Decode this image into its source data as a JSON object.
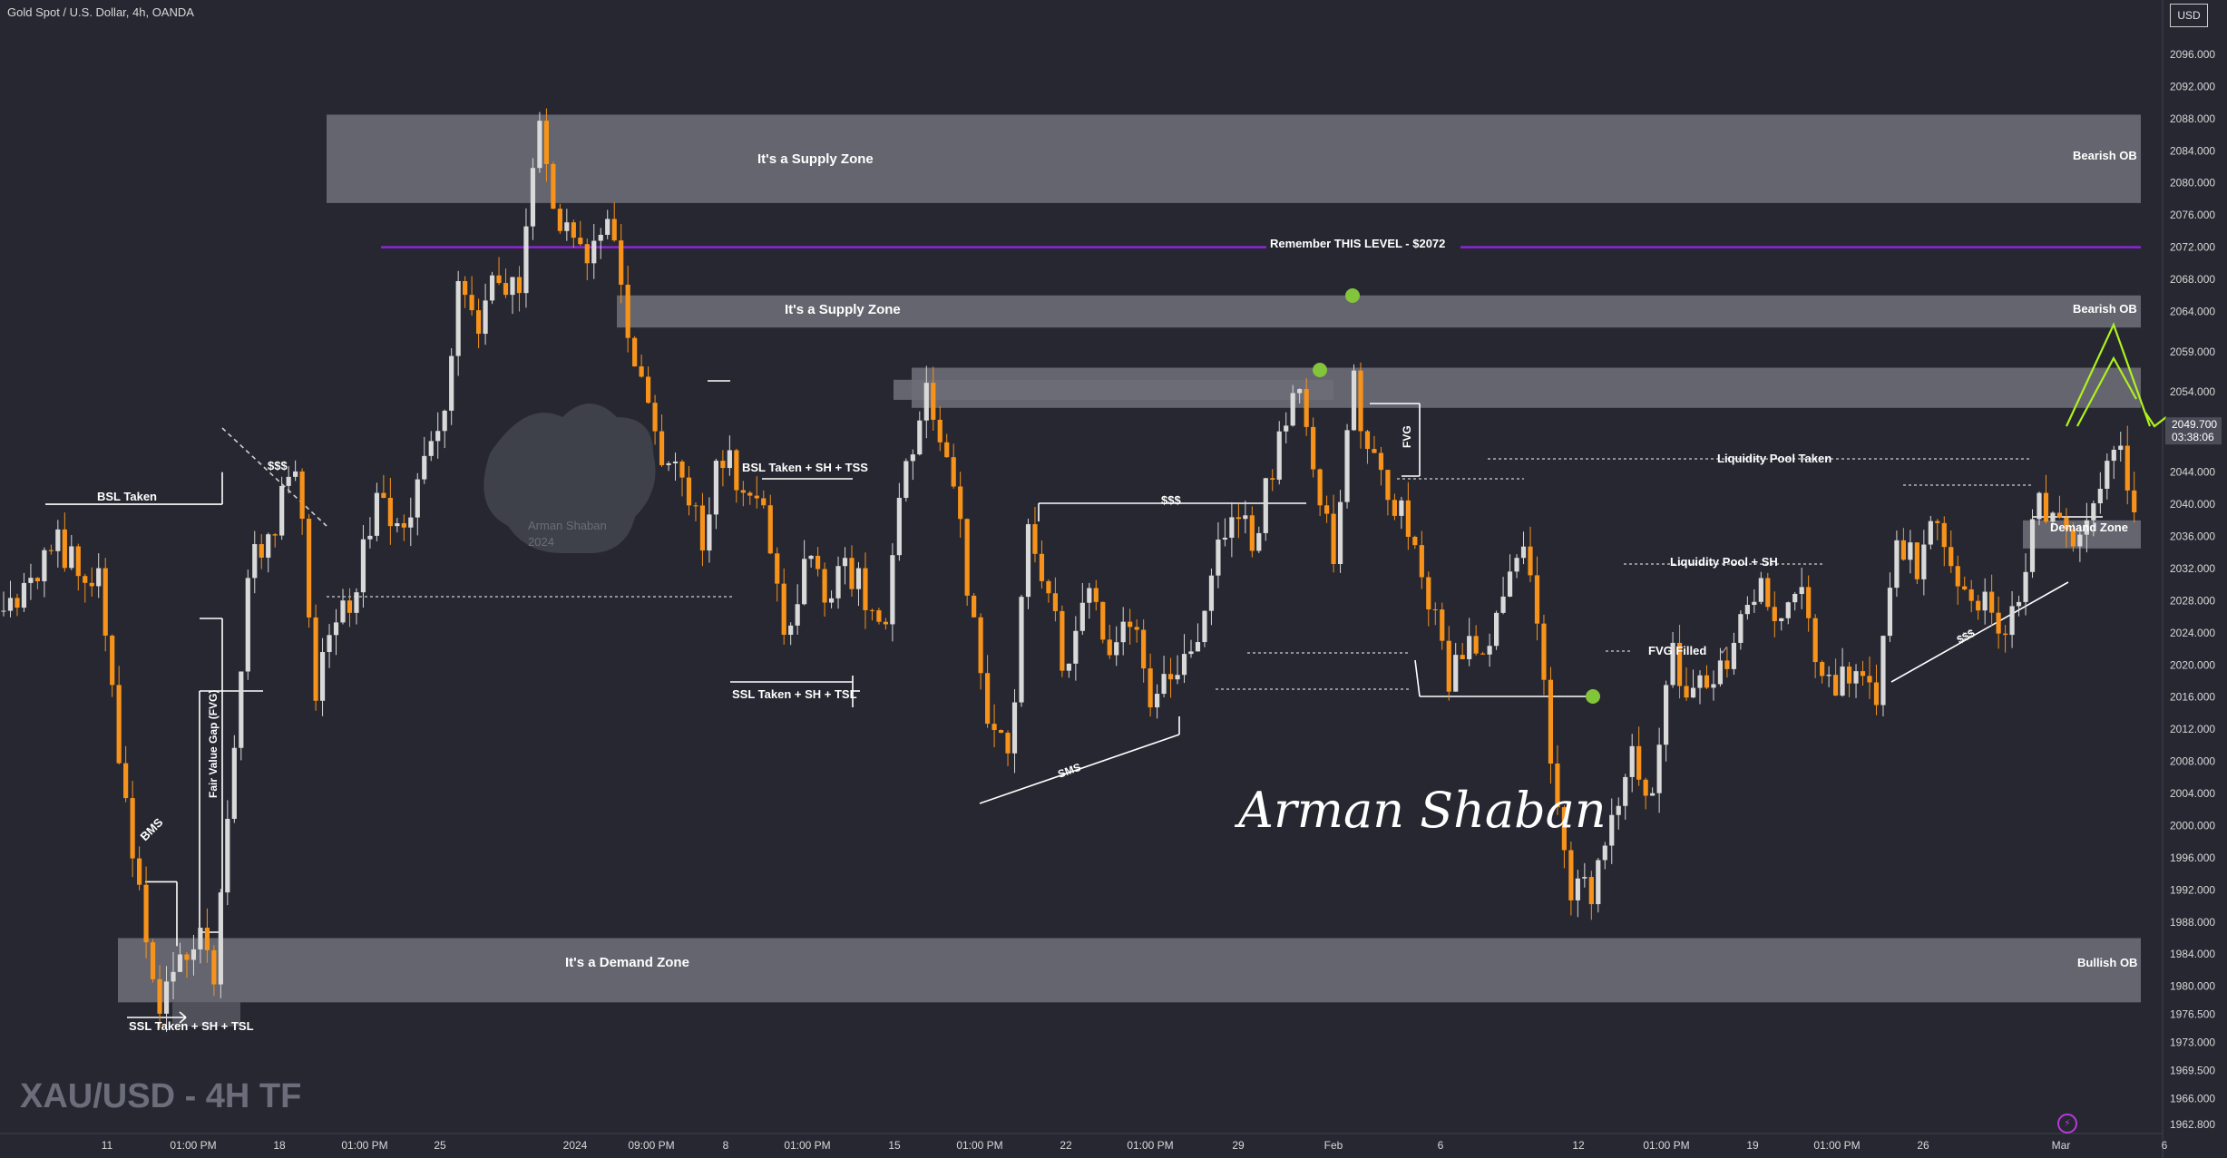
{
  "header": {
    "symbol": "Gold Spot / U.S. Dollar, 4h, OANDA",
    "currency": "USD"
  },
  "bottom_title": "XAU/USD - 4H TF",
  "watermark": {
    "name": "Arman Shaban",
    "year": "2024"
  },
  "signature": "Arman Shaban",
  "colors": {
    "background": "#262731",
    "up_candle": "#d9d9d9",
    "down_candle": "#f7931a",
    "zone": "#6c6d77",
    "purple_line": "#8e24d6",
    "green_arrow": "#aef21d",
    "green_dot": "#82c43a"
  },
  "chart_data": {
    "type": "candlestick",
    "title": "Gold Spot / U.S. Dollar, 4h, OANDA",
    "y_axis": {
      "side": "right",
      "unit": "USD",
      "ticks": [
        "2096.000",
        "2092.000",
        "2088.000",
        "2084.000",
        "2080.000",
        "2076.000",
        "2072.000",
        "2068.000",
        "2064.000",
        "2059.000",
        "2054.000",
        "2049.700",
        "2044.000",
        "2040.000",
        "2036.000",
        "2032.000",
        "2028.000",
        "2024.000",
        "2020.000",
        "2016.000",
        "2012.000",
        "2008.000",
        "2004.000",
        "2000.000",
        "1996.000",
        "1992.000",
        "1988.000",
        "1984.000",
        "1980.000",
        "1976.500",
        "1973.000",
        "1969.500",
        "1966.000",
        "1962.800"
      ],
      "current_price": "2049.700",
      "countdown": "03:38:06"
    },
    "x_axis": {
      "ticks": [
        "11",
        "01:00 PM",
        "18",
        "01:00 PM",
        "25",
        "2024",
        "09:00 PM",
        "8",
        "01:00 PM",
        "15",
        "01:00 PM",
        "22",
        "01:00 PM",
        "29",
        "Feb",
        "6",
        "12",
        "01:00 PM",
        "19",
        "01:00 PM",
        "26",
        "Mar",
        "6"
      ]
    },
    "price_range": [
      1962.8,
      2096.0
    ],
    "close_path": [
      [
        0,
        2026
      ],
      [
        8,
        2035
      ],
      [
        14,
        2030
      ],
      [
        18,
        2003
      ],
      [
        21,
        1985
      ],
      [
        23,
        1978
      ],
      [
        26,
        1983
      ],
      [
        29,
        1986
      ],
      [
        31,
        1980
      ],
      [
        33,
        1999
      ],
      [
        36,
        2032
      ],
      [
        40,
        2038
      ],
      [
        43,
        2046
      ],
      [
        46,
        2018
      ],
      [
        49,
        2025
      ],
      [
        52,
        2030
      ],
      [
        55,
        2040
      ],
      [
        58,
        2036
      ],
      [
        61,
        2042
      ],
      [
        64,
        2048
      ],
      [
        67,
        2066
      ],
      [
        70,
        2063
      ],
      [
        73,
        2069
      ],
      [
        76,
        2066
      ],
      [
        79,
        2088
      ],
      [
        81,
        2076
      ],
      [
        83,
        2073
      ],
      [
        86,
        2070
      ],
      [
        89,
        2077
      ],
      [
        92,
        2062
      ],
      [
        96,
        2048
      ],
      [
        100,
        2043
      ],
      [
        103,
        2036
      ],
      [
        106,
        2047
      ],
      [
        109,
        2042
      ],
      [
        112,
        2041
      ],
      [
        115,
        2022
      ],
      [
        118,
        2033
      ],
      [
        121,
        2029
      ],
      [
        124,
        2032
      ],
      [
        127,
        2029
      ],
      [
        130,
        2024
      ],
      [
        133,
        2046
      ],
      [
        136,
        2053
      ],
      [
        139,
        2048
      ],
      [
        142,
        2030
      ],
      [
        145,
        2014
      ],
      [
        148,
        2008
      ],
      [
        151,
        2036
      ],
      [
        154,
        2027
      ],
      [
        157,
        2019
      ],
      [
        160,
        2031
      ],
      [
        163,
        2020
      ],
      [
        166,
        2026
      ],
      [
        169,
        2015
      ],
      [
        172,
        2018
      ],
      [
        175,
        2020
      ],
      [
        178,
        2033
      ],
      [
        181,
        2038
      ],
      [
        184,
        2036
      ],
      [
        187,
        2044
      ],
      [
        190,
        2056
      ],
      [
        193,
        2046
      ],
      [
        196,
        2033
      ],
      [
        199,
        2055
      ],
      [
        201,
        2047
      ],
      [
        204,
        2040
      ],
      [
        207,
        2037
      ],
      [
        210,
        2028
      ],
      [
        213,
        2018
      ],
      [
        216,
        2024
      ],
      [
        219,
        2023
      ],
      [
        222,
        2034
      ],
      [
        225,
        2033
      ],
      [
        228,
        2009
      ],
      [
        231,
        1993
      ],
      [
        234,
        1991
      ],
      [
        237,
        2003
      ],
      [
        240,
        2008
      ],
      [
        243,
        2005
      ],
      [
        246,
        2021
      ],
      [
        249,
        2016
      ],
      [
        252,
        2018
      ],
      [
        255,
        2022
      ],
      [
        258,
        2030
      ],
      [
        261,
        2027
      ],
      [
        264,
        2030
      ],
      [
        267,
        2022
      ],
      [
        270,
        2017
      ],
      [
        273,
        2021
      ],
      [
        276,
        2016
      ],
      [
        279,
        2036
      ],
      [
        282,
        2032
      ],
      [
        285,
        2038
      ],
      [
        288,
        2032
      ],
      [
        291,
        2028
      ],
      [
        294,
        2024
      ],
      [
        297,
        2027
      ],
      [
        300,
        2040
      ],
      [
        303,
        2036
      ],
      [
        306,
        2034
      ],
      [
        309,
        2043
      ],
      [
        312,
        2045
      ],
      [
        314,
        2039
      ]
    ],
    "annotations": [
      {
        "label": "It's a Supply Zone",
        "type": "zone"
      },
      {
        "label": "Bearish OB",
        "type": "zone_tag"
      },
      {
        "label": "It's a Supply Zone",
        "type": "zone"
      },
      {
        "label": "Bearish OB",
        "type": "zone_tag"
      },
      {
        "label": "It's a Demand Zone",
        "type": "zone"
      },
      {
        "label": "Bullish OB",
        "type": "zone_tag"
      },
      {
        "label": "Demand Zone",
        "type": "zone_tag"
      },
      {
        "label": "Remember THIS LEVEL - $2072",
        "type": "level",
        "price": 2072
      },
      {
        "label": "BSL Taken",
        "type": "text"
      },
      {
        "label": "$$$",
        "type": "text"
      },
      {
        "label": "BMS",
        "type": "text"
      },
      {
        "label": "Fair Value Gap (FVG)",
        "type": "text"
      },
      {
        "label": "SSL Taken + SH + TSL",
        "type": "text"
      },
      {
        "label": "BSL Taken + SH + TSS",
        "type": "text"
      },
      {
        "label": "SSL Taken + SH + TSL",
        "type": "text"
      },
      {
        "label": "$$$",
        "type": "text"
      },
      {
        "label": "SMS",
        "type": "text"
      },
      {
        "label": "FVG",
        "type": "text"
      },
      {
        "label": "Liquidity Pool Taken",
        "type": "text"
      },
      {
        "label": "Liquidity Pool + SH",
        "type": "text"
      },
      {
        "label": "FVG Filled",
        "type": "text"
      },
      {
        "label": "$$$",
        "type": "text"
      }
    ]
  }
}
